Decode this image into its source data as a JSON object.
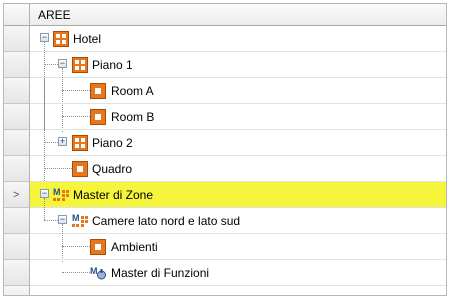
{
  "header": {
    "title": "AREE"
  },
  "tree": {
    "hotel": "Hotel",
    "piano1": "Piano 1",
    "roomA": "Room A",
    "roomB": "Room B",
    "piano2": "Piano 2",
    "quadro": "Quadro",
    "master_zone": "Master di Zone",
    "camere": "Camere lato nord e lato sud",
    "ambienti": "Ambienti",
    "master_funzioni": "Master di Funzioni"
  },
  "icons": {
    "expanded": "minus-icon",
    "collapsed": "plus-icon",
    "area_group": "grid-icon",
    "room": "room-icon",
    "zone_master": "zone-master-icon",
    "function_master": "function-master-icon",
    "current_row": "arrow-right-icon"
  },
  "colors": {
    "highlight": "#f5f53b",
    "icon_orange": "#e8761c"
  }
}
